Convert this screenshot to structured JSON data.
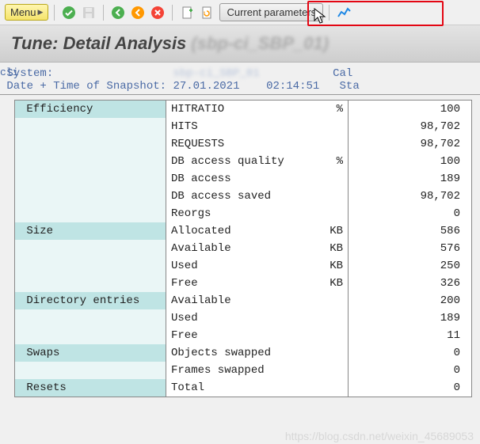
{
  "toolbar": {
    "menu_label": "Menu",
    "current_params_label": "Current parameters"
  },
  "title": {
    "main": "Tune: Detail Analysis ",
    "blurred": "(sbp-ci_SBP_01)"
  },
  "cli_text": "cli",
  "info": {
    "system_label": "System:",
    "system_value_blur": "sbp-ci_SBP_01",
    "cal_partial": "Cal",
    "date_label": "Date + Time of Snapshot:",
    "date_value": "27.01.2021",
    "time_value": "02:14:51",
    "sta_partial": "Sta"
  },
  "table": {
    "rows": [
      {
        "cat": "Efficiency",
        "desc": "HITRATIO",
        "unit": "%",
        "val": "100",
        "hdr": true
      },
      {
        "cat": "",
        "desc": "HITS",
        "unit": "",
        "val": "98,702"
      },
      {
        "cat": "",
        "desc": "REQUESTS",
        "unit": "",
        "val": "98,702"
      },
      {
        "cat": "",
        "desc": "DB access quality",
        "unit": "%",
        "val": "100"
      },
      {
        "cat": "",
        "desc": "DB access",
        "unit": "",
        "val": "189"
      },
      {
        "cat": "",
        "desc": "DB access saved",
        "unit": "",
        "val": "98,702"
      },
      {
        "cat": "",
        "desc": "Reorgs",
        "unit": "",
        "val": "0"
      },
      {
        "cat": "Size",
        "desc": "Allocated",
        "unit": "KB",
        "val": "586",
        "hdr": true
      },
      {
        "cat": "",
        "desc": "Available",
        "unit": "KB",
        "val": "576"
      },
      {
        "cat": "",
        "desc": "Used",
        "unit": "KB",
        "val": "250"
      },
      {
        "cat": "",
        "desc": "Free",
        "unit": "KB",
        "val": "326"
      },
      {
        "cat": "Directory entries",
        "desc": "Available",
        "unit": "",
        "val": "200",
        "hdr": true
      },
      {
        "cat": "",
        "desc": "Used",
        "unit": "",
        "val": "189"
      },
      {
        "cat": "",
        "desc": "Free",
        "unit": "",
        "val": "11"
      },
      {
        "cat": "Swaps",
        "desc": "Objects swapped",
        "unit": "",
        "val": "0",
        "hdr": true
      },
      {
        "cat": "",
        "desc": "Frames swapped",
        "unit": "",
        "val": "0"
      },
      {
        "cat": "Resets",
        "desc": "Total",
        "unit": "",
        "val": "0",
        "hdr": true
      }
    ]
  },
  "chart_data": {
    "type": "table",
    "title": "Tune: Detail Analysis",
    "groups": [
      {
        "name": "Efficiency",
        "metrics": [
          {
            "name": "HITRATIO",
            "unit": "%",
            "value": 100
          },
          {
            "name": "HITS",
            "value": 98702
          },
          {
            "name": "REQUESTS",
            "value": 98702
          },
          {
            "name": "DB access quality",
            "unit": "%",
            "value": 100
          },
          {
            "name": "DB access",
            "value": 189
          },
          {
            "name": "DB access saved",
            "value": 98702
          },
          {
            "name": "Reorgs",
            "value": 0
          }
        ]
      },
      {
        "name": "Size",
        "metrics": [
          {
            "name": "Allocated",
            "unit": "KB",
            "value": 586
          },
          {
            "name": "Available",
            "unit": "KB",
            "value": 576
          },
          {
            "name": "Used",
            "unit": "KB",
            "value": 250
          },
          {
            "name": "Free",
            "unit": "KB",
            "value": 326
          }
        ]
      },
      {
        "name": "Directory entries",
        "metrics": [
          {
            "name": "Available",
            "value": 200
          },
          {
            "name": "Used",
            "value": 189
          },
          {
            "name": "Free",
            "value": 11
          }
        ]
      },
      {
        "name": "Swaps",
        "metrics": [
          {
            "name": "Objects swapped",
            "value": 0
          },
          {
            "name": "Frames swapped",
            "value": 0
          }
        ]
      },
      {
        "name": "Resets",
        "metrics": [
          {
            "name": "Total",
            "value": 0
          }
        ]
      }
    ]
  },
  "watermark": "https://blog.csdn.net/weixin_45689053"
}
